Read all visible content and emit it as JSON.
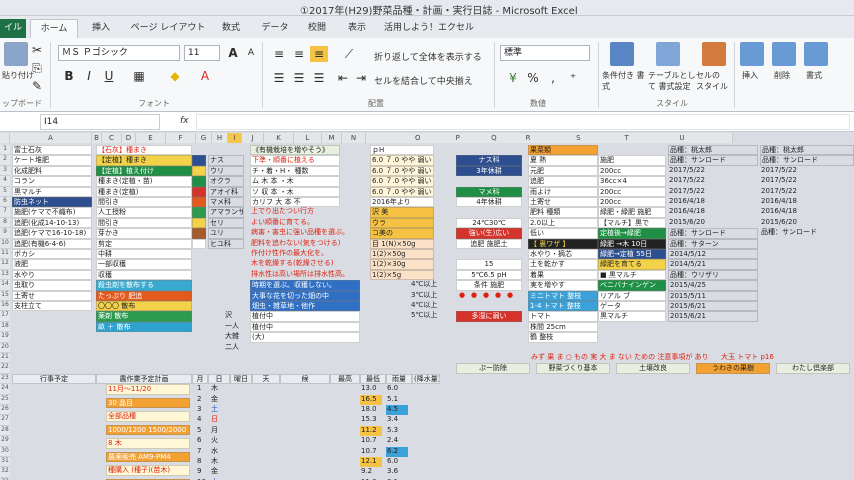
{
  "window": {
    "title": "①2017年(H29)野菜品種・計画・実行日誌 - Microsoft Excel"
  },
  "tabs": [
    {
      "label": "イル"
    },
    {
      "label": "ホーム"
    },
    {
      "label": "挿入"
    },
    {
      "label": "ページ レイアウト"
    },
    {
      "label": "数式"
    },
    {
      "label": "データ"
    },
    {
      "label": "校閲"
    },
    {
      "label": "表示"
    },
    {
      "label": "活用しよう！エクセル"
    }
  ],
  "ribbon": {
    "clipboard": {
      "paste": "貼り付け",
      "group": "ップボード"
    },
    "font": {
      "name": "ＭＳ Ｐゴシック",
      "size": "11",
      "group": "フォント",
      "bold": "B",
      "italic": "I",
      "underline": "U",
      "grow": "A",
      "shrink": "A"
    },
    "alignment": {
      "wrap": "折り返して全体を表示する",
      "merge": "セルを結合して中央揃え",
      "group": "配置"
    },
    "number": {
      "format": "標準",
      "percent": "%",
      "comma": ",",
      "group": "数値"
    },
    "styles": {
      "conditional": "条件付き 書式",
      "table": "テーブルとして 書式設定",
      "cell": "セルの スタイル",
      "group": "スタイル"
    },
    "cells": {
      "insert": "挿入",
      "delete": "削除",
      "format": "書式"
    }
  },
  "formula": {
    "namebox": "I14",
    "fx": "fx",
    "value": ""
  },
  "columns": [
    "A",
    "B",
    "C",
    "D",
    "E",
    "F",
    "G",
    "H",
    "I",
    "J",
    "K",
    "L",
    "M",
    "N",
    "O",
    "P",
    "Q",
    "R",
    "S",
    "T",
    "U"
  ],
  "rows": [
    "1",
    "2",
    "3",
    "4",
    "5",
    "6",
    "7",
    "8",
    "9",
    "10",
    "11",
    "12",
    "13",
    "14",
    "15",
    "16",
    "17",
    "18",
    "19",
    "20",
    "21",
    "22",
    "23",
    "24",
    "25",
    "26",
    "27",
    "28",
    "29",
    "30",
    "31",
    "32",
    "33"
  ],
  "cells": {
    "a_list": [
      "富士石灰",
      "ケート堆肥",
      "化成肥料",
      "コラン",
      "黒マルチ",
      "防虫ネット",
      "施肥(ケマで不織布)",
      "追肥(化成14-10-13)",
      "追肥(ケマで16-10-18)",
      "追肥(有機6-4-6)",
      "ボカシ",
      "液肥",
      "水やり",
      "虫取り",
      "土寄せ",
      "支柱立て"
    ],
    "b_list": [
      "【石灰】種まき",
      "【定植】種まき",
      "【定植】植え付け",
      "種まき(定植・苗)",
      "種まき(定植)",
      "間引き",
      "人工授粉",
      "間引き",
      "芽かき",
      "剪定",
      "中耕",
      "一部収穫",
      "収穫",
      "殺虫剤を散布する",
      "たっぷり 肥追",
      "〇〇〇 散布",
      "薬剤 散布",
      "畝 ＋ 散布"
    ],
    "e_list": [
      "ナス",
      "ウリ",
      "オクラ",
      "アオイ科",
      "マメ科",
      "アマランサス",
      "セリ",
      "ユリ",
      "ヒユ科"
    ],
    "g_block": [
      "《有機栽培を増やそう》",
      "下準・順番に植える",
      "チ・着・H・ 種数",
      "ム 木 本 ・木",
      "ソ 収 本 ・木",
      "カリフ 大 本 不"
    ],
    "g_notes": [
      "上でり出たつい行方",
      "よい順番に育てる。",
      "病害・害虫に強い品種を選ぶ。",
      "肥料を追わない(気をつける)",
      "作付け性作の最大化を。",
      "木を乾燥する(乾燥させる)",
      "排水性は高い場所は排水性高。"
    ],
    "g_blue": [
      "時期を選ぶ。収穫しない。",
      "大事な花を切った畑の中",
      "畑虫・雑草地・他作",
      "植付中",
      "植付中",
      "(大)"
    ],
    "k_vals": [
      "沢",
      "一人",
      "大雑",
      "二人"
    ],
    "m_block": [
      "ｐH",
      "6.0 ７.0 やや 弱い",
      "6.0 ７.0 やや 弱い",
      "6.0 ７.0 やや 弱い",
      "6.0 ７.0 やや 弱い",
      "2016年より"
    ],
    "m_colored": [
      "沢 美",
      "ウラ",
      "コ美の",
      "目 1(N)×50g",
      "1(2)×50g",
      "1(2)×30g",
      "1(2)×5g"
    ],
    "mid_block": [
      "ナス科",
      "3年休耕",
      "マメ科",
      "4年休耕",
      "24℃30℃",
      "強い(生)広い",
      "追肥 施肥土",
      "15",
      "条件 施肥",
      "多湿に弱い",
      "5℃6.5 pH"
    ],
    "mid_dates": [
      "4℃以上",
      "3℃以上",
      "4℃以上",
      "5℃以上"
    ],
    "q_block": [
      "果菜類",
      "夏 熱",
      "元肥",
      "追肥",
      "雨よけ",
      "土寄せ",
      "肥料 種類",
      "2.0以上",
      "低い",
      "【 裏ワザ 】",
      "水やり・摘芯",
      "土を乾かす",
      "着果",
      "実を増やす",
      "ミニトマト 整枝",
      "1-4 トマト 整枝",
      "トマト",
      "株間 25cm",
      "鶴 整枝"
    ],
    "s_block": [
      "施肥",
      "200cc",
      "36cc×4",
      "200cc",
      "200cc",
      "緑肥・緑肥 施肥",
      "【マルチ】黒で",
      "定植後→緑肥",
      "緑肥 →木 10日",
      "緑肥→定植 55日",
      "緑肥を育てる",
      "■ 黒マルチ",
      "ベニバナインゲン",
      "リアル ブ",
      "ゲータ",
      "黒マルチ"
    ],
    "v_block": [
      "品種：桃太郎",
      "品種：サンロード",
      "2017/5/22",
      "2017/5/22",
      "2017/5/22",
      "2016/4/18",
      "2016/4/18",
      "2015/6/20",
      "品種：サンロード",
      "品種：サターン",
      "2014/5/12",
      "2014/5/21",
      "品種：ウリザリ",
      "2015/4/25",
      "2015/5/11",
      "2015/6/21",
      "2015/6/21"
    ],
    "row23": [
      "行事予定",
      "農作業予定計画",
      "月",
      "日",
      "曜日",
      "天",
      "候",
      "最高",
      "最低",
      "雨量",
      "(降水量)"
    ],
    "row24": [
      "11月",
      "12(水)",
      "1",
      "木",
      "晴",
      "曇",
      "13.0",
      "16.5",
      "6.0"
    ],
    "row_dates": [
      "1",
      "2",
      "3",
      "4",
      "5",
      "6",
      "7",
      "8",
      "9",
      "10",
      "11"
    ],
    "row_days": [
      "木",
      "金",
      "土",
      "日",
      "月",
      "火",
      "水",
      "木",
      "金",
      "土",
      "日"
    ],
    "row_temps": [
      "13.0",
      "16.5",
      "18.0",
      "15.3",
      "11.2",
      "10.7",
      "10.7",
      "12.1",
      "9.2",
      "11.0",
      "8.7"
    ],
    "row_low": [
      "6.0",
      "5.1",
      "4.5",
      "3.4",
      "5.3",
      "2.4",
      "6.2",
      "6.0",
      "3.6",
      "0.1",
      "3.3"
    ],
    "b_sched": [
      "11月～11/20",
      "30 晶目",
      "全部品種",
      "1000/1200 1500/2000",
      "8 木",
      "農薬販売 AM9-PM4",
      "種購入 (種子)(苗木)",
      "10月 種植えの日に"
    ],
    "row22_tabs": [
      "ぷー防除",
      "野菜づくり基本",
      "土壌改良",
      "うわきの果樹",
      "わたし倶楽部"
    ],
    "row21_text": [
      "みず 果 ま ○ もの 実 大 ま ない ための 注意事項が あります",
      "大玉 トマト p16"
    ],
    "o_dots": [
      "●",
      "●",
      "●",
      "●",
      "●"
    ]
  }
}
